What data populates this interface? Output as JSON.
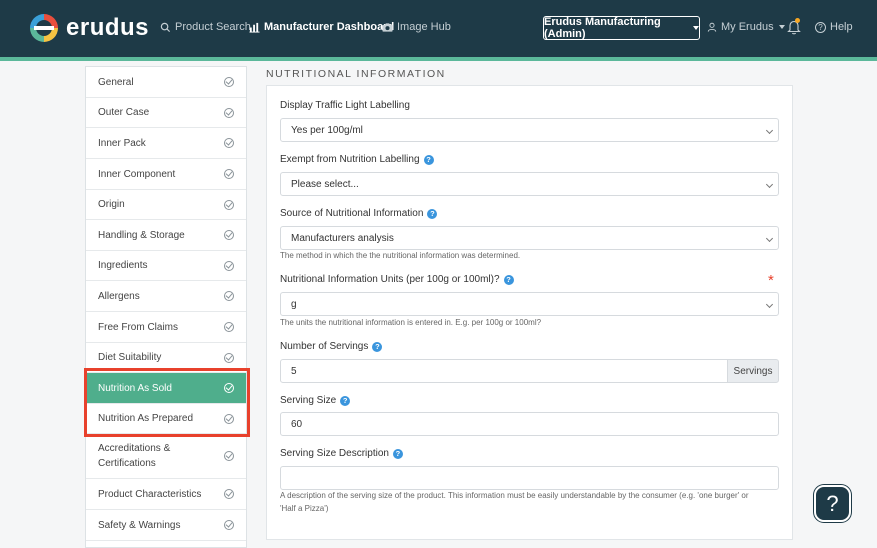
{
  "header": {
    "logo_text": "erudus",
    "nav": {
      "product_search": "Product Search",
      "manufacturer_dashboard": "Manufacturer Dashboard",
      "image_hub": "Image Hub"
    },
    "account": "Erudus Manufacturing (Admin)",
    "my_erudus": "My Erudus",
    "help": "Help"
  },
  "sidebar": {
    "items": [
      {
        "label": "General"
      },
      {
        "label": "Outer Case"
      },
      {
        "label": "Inner Pack"
      },
      {
        "label": "Inner Component"
      },
      {
        "label": "Origin"
      },
      {
        "label": "Handling & Storage"
      },
      {
        "label": "Ingredients"
      },
      {
        "label": "Allergens"
      },
      {
        "label": "Free From Claims"
      },
      {
        "label": "Diet Suitability"
      },
      {
        "label": "Nutrition As Sold"
      },
      {
        "label": "Nutrition As Prepared"
      },
      {
        "label": "Accreditations &",
        "label2": "Certifications"
      },
      {
        "label": "Product Characteristics"
      },
      {
        "label": "Safety & Warnings"
      }
    ],
    "active_item": "Nutrition As Sold"
  },
  "main": {
    "section_title": "NUTRITIONAL INFORMATION",
    "traffic_light": {
      "label": "Display Traffic Light Labelling",
      "value": "Yes per 100g/ml"
    },
    "exempt": {
      "label": "Exempt from Nutrition Labelling",
      "value": "Please select..."
    },
    "source": {
      "label": "Source of Nutritional Information",
      "value": "Manufacturers analysis",
      "hint": "The method in which the the nutritional information was determined."
    },
    "units": {
      "label": "Nutritional Information Units (per 100g or 100ml)?",
      "value": "g",
      "required_mark": "*",
      "hint": "The units the nutritional information is entered in. E.g. per 100g or 100ml?"
    },
    "servings": {
      "label": "Number of Servings",
      "value": "5",
      "addon": "Servings"
    },
    "serving_size": {
      "label": "Serving Size",
      "value": "60"
    },
    "serving_desc": {
      "label": "Serving Size Description",
      "value": "",
      "hint_line1": "A description of the serving size of the product. This information must be easily understandable by the consumer (e.g. 'one burger' or",
      "hint_line2": "'Half a Pizza')"
    }
  },
  "help_fab": "?",
  "colors": {
    "header_bg": "#1e3a47",
    "accent": "#4fae8c",
    "highlight": "#e8412c",
    "info": "#3a95dd"
  }
}
